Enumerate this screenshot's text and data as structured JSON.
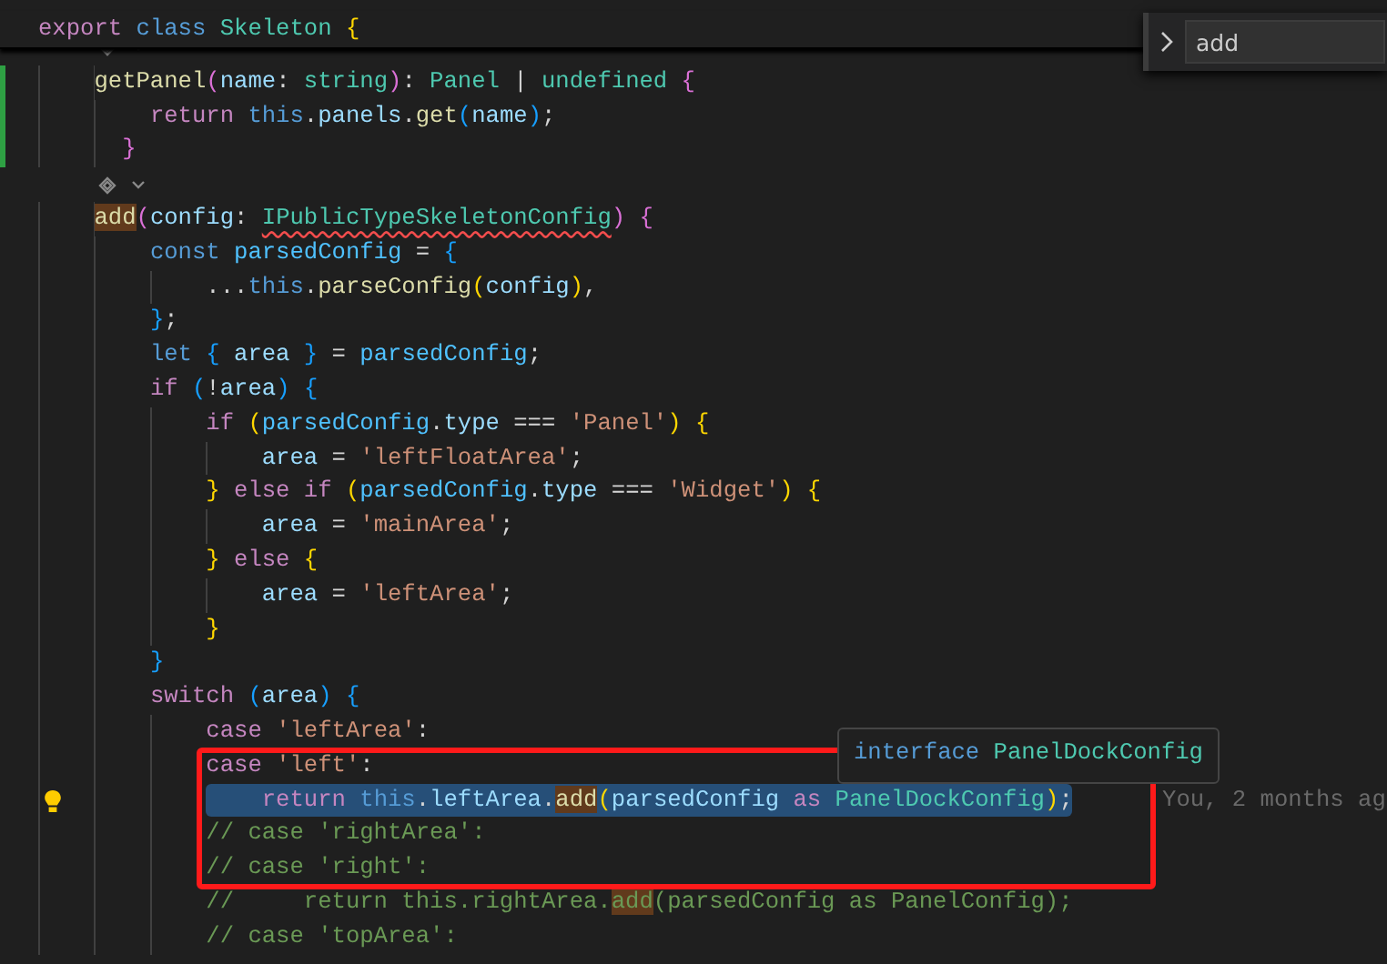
{
  "sticky_header": {
    "tokens": [
      {
        "text": "export ",
        "kind": "control"
      },
      {
        "text": "class ",
        "kind": "keyword"
      },
      {
        "text": "Skeleton ",
        "kind": "type"
      },
      {
        "text": "{",
        "kind": "gold"
      }
    ]
  },
  "find_widget": {
    "value": "add"
  },
  "lines": [
    {
      "kind": "lens"
    },
    {
      "kind": "code",
      "modified": true,
      "selected": false,
      "tokens": [
        {
          "text": "    getPanel",
          "kind": "function"
        },
        {
          "text": "(",
          "kind": "pink"
        },
        {
          "text": "name",
          "kind": "variable"
        },
        {
          "text": ": ",
          "kind": "plain"
        },
        {
          "text": "string",
          "kind": "type"
        },
        {
          "text": ")",
          "kind": "pink"
        },
        {
          "text": ": ",
          "kind": "plain"
        },
        {
          "text": "Panel",
          "kind": "type"
        },
        {
          "text": " | ",
          "kind": "plain"
        },
        {
          "text": "undefined ",
          "kind": "type"
        },
        {
          "text": "{",
          "kind": "pink"
        }
      ]
    },
    {
      "kind": "code",
      "modified": true,
      "selected": false,
      "tokens": [
        {
          "text": "        return ",
          "kind": "control"
        },
        {
          "text": "this",
          "kind": "keyword"
        },
        {
          "text": ".",
          "kind": "plain"
        },
        {
          "text": "panels",
          "kind": "variable"
        },
        {
          "text": ".",
          "kind": "plain"
        },
        {
          "text": "get",
          "kind": "function"
        },
        {
          "text": "(",
          "kind": "blue"
        },
        {
          "text": "name",
          "kind": "variable"
        },
        {
          "text": ")",
          "kind": "blue"
        },
        {
          "text": ";",
          "kind": "plain"
        }
      ]
    },
    {
      "kind": "code",
      "modified": true,
      "selected": false,
      "tokens": [
        {
          "text": "      }",
          "kind": "pink"
        }
      ]
    },
    {
      "kind": "lens"
    },
    {
      "kind": "code",
      "selected": false,
      "tokens": [
        {
          "text": "    add",
          "kind": "function",
          "match": true
        },
        {
          "text": "(",
          "kind": "pink"
        },
        {
          "text": "config",
          "kind": "variable"
        },
        {
          "text": ": ",
          "kind": "plain"
        },
        {
          "text": "IPublicTypeSkeletonConfig",
          "kind": "type",
          "squiggle": true
        },
        {
          "text": ")",
          "kind": "pink"
        },
        {
          "text": " {",
          "kind": "pink"
        }
      ]
    },
    {
      "kind": "code",
      "selected": false,
      "tokens": [
        {
          "text": "        const ",
          "kind": "keyword"
        },
        {
          "text": "parsedConfig",
          "kind": "constant"
        },
        {
          "text": " = ",
          "kind": "plain"
        },
        {
          "text": "{",
          "kind": "blue"
        }
      ]
    },
    {
      "kind": "code",
      "selected": false,
      "tokens": [
        {
          "text": "            ...",
          "kind": "plain"
        },
        {
          "text": "this",
          "kind": "keyword"
        },
        {
          "text": ".",
          "kind": "plain"
        },
        {
          "text": "parseConfig",
          "kind": "function"
        },
        {
          "text": "(",
          "kind": "gold"
        },
        {
          "text": "config",
          "kind": "variable"
        },
        {
          "text": ")",
          "kind": "gold"
        },
        {
          "text": ",",
          "kind": "plain"
        }
      ]
    },
    {
      "kind": "code",
      "selected": false,
      "tokens": [
        {
          "text": "        }",
          "kind": "blue"
        },
        {
          "text": ";",
          "kind": "plain"
        }
      ]
    },
    {
      "kind": "code",
      "selected": false,
      "tokens": [
        {
          "text": "        let ",
          "kind": "keyword"
        },
        {
          "text": "{",
          "kind": "blue"
        },
        {
          "text": " area ",
          "kind": "variable"
        },
        {
          "text": "}",
          "kind": "blue"
        },
        {
          "text": " = ",
          "kind": "plain"
        },
        {
          "text": "parsedConfig",
          "kind": "constant"
        },
        {
          "text": ";",
          "kind": "plain"
        }
      ]
    },
    {
      "kind": "code",
      "selected": false,
      "tokens": [
        {
          "text": "        if ",
          "kind": "control"
        },
        {
          "text": "(",
          "kind": "blue"
        },
        {
          "text": "!",
          "kind": "plain"
        },
        {
          "text": "area",
          "kind": "variable"
        },
        {
          "text": ")",
          "kind": "blue"
        },
        {
          "text": " {",
          "kind": "blue"
        }
      ]
    },
    {
      "kind": "code",
      "selected": false,
      "tokens": [
        {
          "text": "            if ",
          "kind": "control"
        },
        {
          "text": "(",
          "kind": "gold"
        },
        {
          "text": "parsedConfig",
          "kind": "constant"
        },
        {
          "text": ".",
          "kind": "plain"
        },
        {
          "text": "type",
          "kind": "variable"
        },
        {
          "text": " === ",
          "kind": "plain"
        },
        {
          "text": "'Panel'",
          "kind": "string"
        },
        {
          "text": ")",
          "kind": "gold"
        },
        {
          "text": " {",
          "kind": "gold"
        }
      ]
    },
    {
      "kind": "code",
      "selected": false,
      "tokens": [
        {
          "text": "                area",
          "kind": "variable"
        },
        {
          "text": " = ",
          "kind": "plain"
        },
        {
          "text": "'leftFloatArea'",
          "kind": "string"
        },
        {
          "text": ";",
          "kind": "plain"
        }
      ]
    },
    {
      "kind": "code",
      "selected": false,
      "tokens": [
        {
          "text": "            }",
          "kind": "gold"
        },
        {
          "text": " else if ",
          "kind": "control"
        },
        {
          "text": "(",
          "kind": "gold"
        },
        {
          "text": "parsedConfig",
          "kind": "constant"
        },
        {
          "text": ".",
          "kind": "plain"
        },
        {
          "text": "type",
          "kind": "variable"
        },
        {
          "text": " === ",
          "kind": "plain"
        },
        {
          "text": "'Widget'",
          "kind": "string"
        },
        {
          "text": ")",
          "kind": "gold"
        },
        {
          "text": " {",
          "kind": "gold"
        }
      ]
    },
    {
      "kind": "code",
      "selected": false,
      "tokens": [
        {
          "text": "                area",
          "kind": "variable"
        },
        {
          "text": " = ",
          "kind": "plain"
        },
        {
          "text": "'mainArea'",
          "kind": "string"
        },
        {
          "text": ";",
          "kind": "plain"
        }
      ]
    },
    {
      "kind": "code",
      "selected": false,
      "tokens": [
        {
          "text": "            }",
          "kind": "gold"
        },
        {
          "text": " else ",
          "kind": "control"
        },
        {
          "text": "{",
          "kind": "gold"
        }
      ]
    },
    {
      "kind": "code",
      "selected": false,
      "tokens": [
        {
          "text": "                area",
          "kind": "variable"
        },
        {
          "text": " = ",
          "kind": "plain"
        },
        {
          "text": "'leftArea'",
          "kind": "string"
        },
        {
          "text": ";",
          "kind": "plain"
        }
      ]
    },
    {
      "kind": "code",
      "selected": false,
      "tokens": [
        {
          "text": "            }",
          "kind": "gold"
        }
      ]
    },
    {
      "kind": "code",
      "selected": false,
      "tokens": [
        {
          "text": "        }",
          "kind": "blue"
        }
      ]
    },
    {
      "kind": "code",
      "selected": false,
      "tokens": [
        {
          "text": "        switch ",
          "kind": "control"
        },
        {
          "text": "(",
          "kind": "blue"
        },
        {
          "text": "area",
          "kind": "variable"
        },
        {
          "text": ")",
          "kind": "blue"
        },
        {
          "text": " {",
          "kind": "blue"
        }
      ]
    },
    {
      "kind": "code",
      "selected": false,
      "tokens": [
        {
          "text": "            case ",
          "kind": "control"
        },
        {
          "text": "'leftArea'",
          "kind": "string"
        },
        {
          "text": ":",
          "kind": "plain"
        }
      ]
    },
    {
      "kind": "code",
      "selected": false,
      "tokens": [
        {
          "text": "            case ",
          "kind": "control"
        },
        {
          "text": "'left'",
          "kind": "string"
        },
        {
          "text": ":",
          "kind": "plain"
        }
      ]
    },
    {
      "kind": "code",
      "selected": true,
      "lightbulb": true,
      "blame": "You, 2 months ag",
      "tokens": [
        {
          "text": "                return ",
          "kind": "control"
        },
        {
          "text": "this",
          "kind": "keyword"
        },
        {
          "text": ".",
          "kind": "plain"
        },
        {
          "text": "leftArea",
          "kind": "variable"
        },
        {
          "text": ".",
          "kind": "plain"
        },
        {
          "text": "add",
          "kind": "function",
          "match": true
        },
        {
          "text": "(",
          "kind": "gold"
        },
        {
          "text": "parsedConfig ",
          "kind": "variable"
        },
        {
          "text": "as ",
          "kind": "control"
        },
        {
          "text": "PanelDockConfig",
          "kind": "type"
        },
        {
          "text": ")",
          "kind": "gold"
        },
        {
          "text": ";",
          "kind": "plain"
        }
      ]
    },
    {
      "kind": "code",
      "selected": false,
      "tokens": [
        {
          "text": "            // case 'rightArea':",
          "kind": "comment"
        }
      ]
    },
    {
      "kind": "code",
      "selected": false,
      "tokens": [
        {
          "text": "            // case 'right':",
          "kind": "comment"
        }
      ]
    },
    {
      "kind": "code",
      "selected": false,
      "tokens": [
        {
          "text": "            //     return this.rightArea.",
          "kind": "comment"
        },
        {
          "text": "add",
          "kind": "comment",
          "match": true
        },
        {
          "text": "(parsedConfig as PanelConfig);",
          "kind": "comment"
        }
      ]
    },
    {
      "kind": "code",
      "selected": false,
      "tokens": [
        {
          "text": "            // case 'topArea':",
          "kind": "comment"
        }
      ]
    }
  ],
  "hover": {
    "tokens": [
      {
        "text": "interface ",
        "kind": "keyword"
      },
      {
        "text": "PanelDockConfig",
        "kind": "type"
      }
    ]
  }
}
